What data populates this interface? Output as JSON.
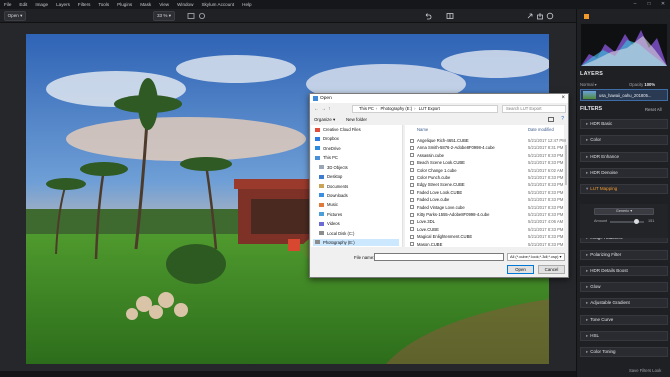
{
  "menu": {
    "items": [
      "File",
      "Edit",
      "Image",
      "Layers",
      "Filters",
      "Tools",
      "Plugins",
      "Mask",
      "View",
      "Window",
      "Skylum Account",
      "Help"
    ],
    "window_controls": [
      "–",
      "□",
      "✕"
    ]
  },
  "toolbar": {
    "open_label": "Open",
    "zoom_label": "33 %"
  },
  "panel": {
    "layers_title": "LAYERS",
    "blend_mode": "Normal",
    "opacity_label": "Opacity",
    "opacity_value": "100%",
    "layer_name": "usa_hawaii_oahu_201805...",
    "filters_title": "FILTERS",
    "reset_all": "Reset All",
    "filters": [
      {
        "label": "HDR Basic",
        "open": false
      },
      {
        "label": "Color",
        "open": false
      },
      {
        "label": "HDR Enhance",
        "open": false
      },
      {
        "label": "HDR Denoise",
        "open": false
      },
      {
        "label": "LUT Mapping",
        "open": true
      },
      {
        "label": "Image Radiance",
        "open": false
      },
      {
        "label": "Polarizing Filter",
        "open": false
      },
      {
        "label": "HDR Details Boost",
        "open": false
      },
      {
        "label": "Glow",
        "open": false
      },
      {
        "label": "Adjustable Gradient",
        "open": false
      },
      {
        "label": "Tone Curve",
        "open": false
      },
      {
        "label": "HSL",
        "open": false
      },
      {
        "label": "Color Toning",
        "open": false
      }
    ],
    "lut": {
      "dropdown": "Generic",
      "amount_label": "Amount",
      "amount_value": "151"
    },
    "save_look": "Save Filters Look"
  },
  "dialog": {
    "title": "Open",
    "breadcrumb": [
      "This PC",
      "Photography (E:)",
      "LUT Export"
    ],
    "search_placeholder": "Search LUT Export",
    "organize": "Organize ▾",
    "new_folder": "New folder",
    "nav_items": [
      "Creative Cloud Files",
      "Dropbox",
      "OneDrive",
      "This PC",
      "3D Objects",
      "Desktop",
      "Documents",
      "Downloads",
      "Music",
      "Pictures",
      "Videos",
      "Local Disk (C:)",
      "Photography (E:)"
    ],
    "nav_selected": "Photography (E:)",
    "columns": {
      "name": "Name",
      "date": "Date modified"
    },
    "files": [
      {
        "name": "Angelique Rich-4651.CUBE",
        "date": "5/21/2017 12:47 PM"
      },
      {
        "name": "Anna Smith-5876-2-Adobe8F0998-4.cube",
        "date": "5/21/2017 8:31 PM"
      },
      {
        "name": "Assassin.cube",
        "date": "5/21/2017 8:33 PM"
      },
      {
        "name": "Beach Scene Look.CUBE",
        "date": "5/21/2017 8:33 PM"
      },
      {
        "name": "Color Change 1.cube",
        "date": "5/21/2017 6:02 AM"
      },
      {
        "name": "Color Punch.cube",
        "date": "5/21/2017 8:33 PM"
      },
      {
        "name": "Edgy Street Scene.CUBE",
        "date": "5/21/2017 8:33 PM"
      },
      {
        "name": "Faded Love Look.CUBE",
        "date": "5/21/2017 8:33 PM"
      },
      {
        "name": "Faded Love.cube",
        "date": "5/21/2017 8:33 PM"
      },
      {
        "name": "Faded Vintage Love.cube",
        "date": "5/21/2017 8:33 PM"
      },
      {
        "name": "Kitty Parks-1555-Adobe8F0998-4.cube",
        "date": "5/21/2017 8:33 PM"
      },
      {
        "name": "Love.3DL",
        "date": "5/21/2017 4:06 AM"
      },
      {
        "name": "Love.CUBE",
        "date": "5/21/2017 8:33 PM"
      },
      {
        "name": "Magical Enlightenment.CUBE",
        "date": "5/21/2017 8:33 PM"
      },
      {
        "name": "Mason.CUBE",
        "date": "5/21/2017 8:33 PM"
      }
    ],
    "file_name_label": "File name:",
    "file_name_value": "",
    "file_type": "All (*.cube;*.look;*.3dl;*.csp)",
    "open_button": "Open",
    "cancel_button": "Cancel"
  }
}
